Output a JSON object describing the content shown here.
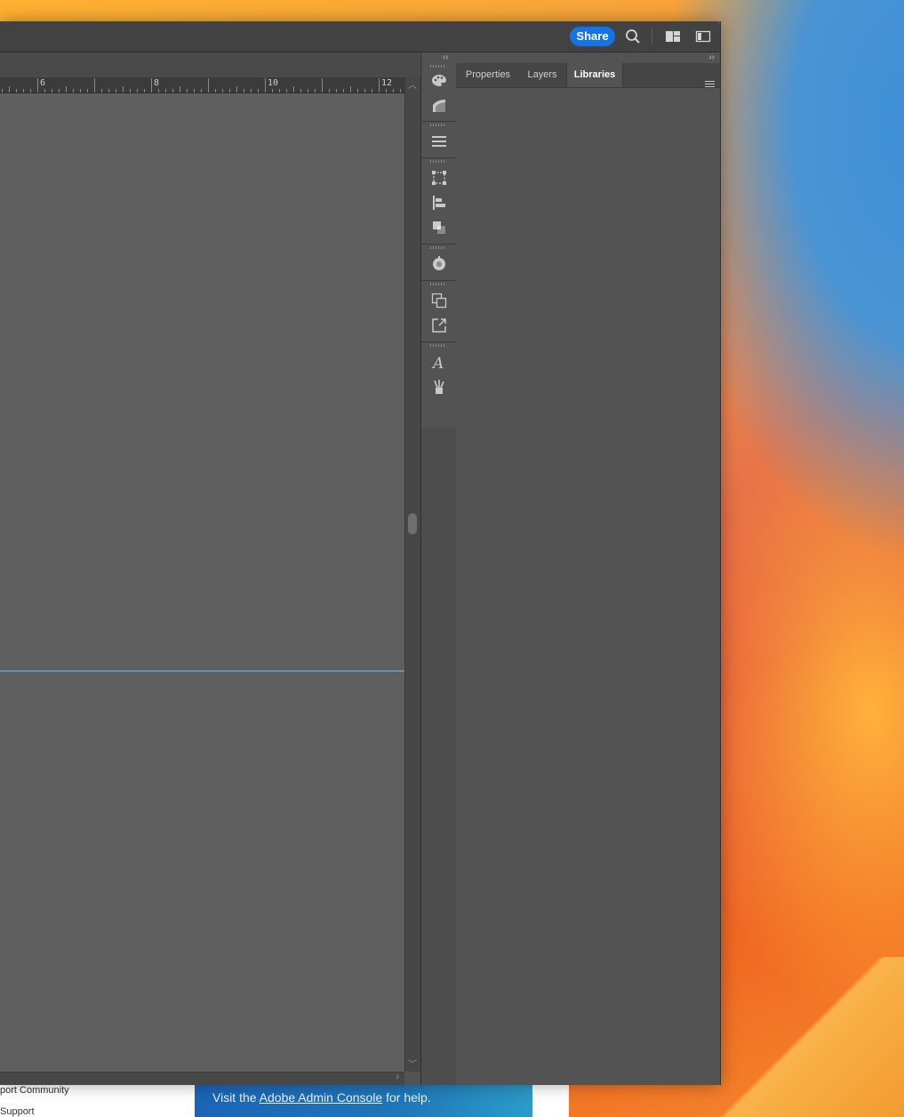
{
  "titlebar": {
    "share_label": "Share",
    "icons": [
      "search-icon",
      "workspace-switcher-icon",
      "arrange-documents-icon"
    ]
  },
  "ruler": {
    "labels": [
      "6",
      "8",
      "10",
      "12"
    ]
  },
  "dock": {
    "collapse_glyph": "‹‹",
    "tools": [
      "color-palette-icon",
      "gradient-icon",
      "stroke-icon",
      "transform-icon",
      "align-icon",
      "pathfinder-icon",
      "appearance-icon",
      "artboards-icon",
      "export-icon",
      "character-styles-icon",
      "brushes-icon"
    ]
  },
  "panel": {
    "expand_glyph": "››",
    "tabs": [
      {
        "label": "Properties",
        "active": false
      },
      {
        "label": "Layers",
        "active": false
      },
      {
        "label": "Libraries",
        "active": true
      }
    ]
  },
  "background": {
    "footer_link_1": "port Community",
    "footer_link_2": "Support",
    "banner_prefix": "Visit the ",
    "banner_link": "Adobe Admin Console",
    "banner_suffix": " for help."
  },
  "colors": {
    "accent": "#1473e6",
    "guide": "#54c7e8"
  }
}
